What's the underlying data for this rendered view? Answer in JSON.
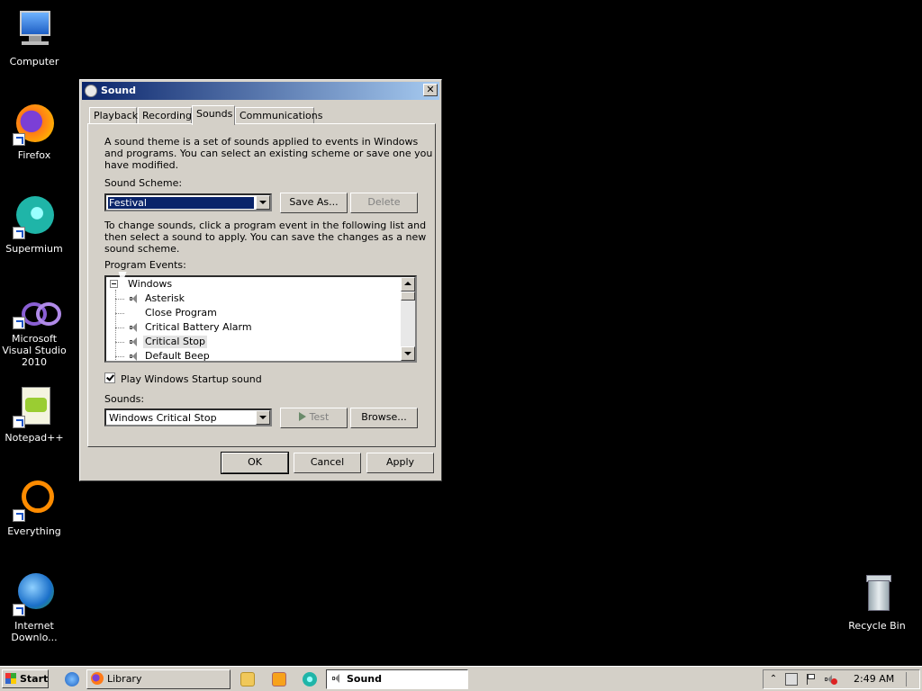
{
  "desktop": {
    "icons": [
      {
        "label": "Computer",
        "icon": "computer-icon"
      },
      {
        "label": "Firefox",
        "icon": "firefox-icon"
      },
      {
        "label": "Supermium",
        "icon": "supermium-icon"
      },
      {
        "label": "Microsoft Visual Studio 2010",
        "icon": "visual-studio-icon"
      },
      {
        "label": "Notepad++",
        "icon": "notepadpp-icon"
      },
      {
        "label": "Everything",
        "icon": "everything-icon"
      },
      {
        "label": "Internet Downlo...",
        "icon": "idm-icon"
      },
      {
        "label": "Recycle Bin",
        "icon": "recycle-bin-icon"
      }
    ]
  },
  "window": {
    "title": "Sound",
    "tabs": [
      "Playback",
      "Recording",
      "Sounds",
      "Communications"
    ],
    "active_tab": "Sounds",
    "theme_description": [
      "A sound theme is a set of sounds applied to events in Windows",
      "and programs.  You can select an existing scheme or save one you",
      "have modified."
    ],
    "scheme_label": "Sound Scheme:",
    "scheme_value": "Festival",
    "save_as_label": "Save As...",
    "delete_label": "Delete",
    "change_instructions": [
      "To change sounds, click a program event in the following list and",
      "then select a sound to apply.  You can save the changes as a new",
      "sound scheme."
    ],
    "events_label": "Program Events:",
    "events": {
      "root": "Windows",
      "items": [
        {
          "label": "Asterisk",
          "has_sound": true
        },
        {
          "label": "Close Program",
          "has_sound": false
        },
        {
          "label": "Critical Battery Alarm",
          "has_sound": true
        },
        {
          "label": "Critical Stop",
          "has_sound": true,
          "selected": true
        },
        {
          "label": "Default Beep",
          "has_sound": true
        }
      ]
    },
    "startup_checkbox_label": "Play Windows Startup sound",
    "startup_checked": true,
    "sounds_label": "Sounds:",
    "sounds_value": "Windows Critical Stop",
    "test_label": "Test",
    "browse_label": "Browse...",
    "ok_label": "OK",
    "cancel_label": "Cancel",
    "apply_label": "Apply"
  },
  "taskbar": {
    "start_label": "Start",
    "buttons": [
      {
        "label": "Library",
        "icon": "firefox-icon",
        "active": false
      },
      {
        "label": "Sound",
        "icon": "speaker-icon",
        "active": true
      }
    ],
    "clock": "2:49 AM"
  }
}
